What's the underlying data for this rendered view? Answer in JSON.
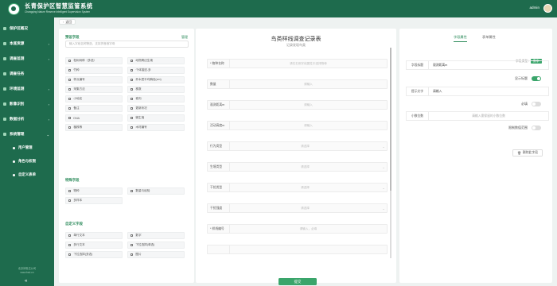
{
  "header": {
    "title": "长青保护区智慧监管系统",
    "subtitle": "Changqing Nature Reserve Intelligent Supervision System",
    "user": "admin"
  },
  "sidebar": {
    "items": [
      {
        "label": "保护区概况"
      },
      {
        "label": "本底资源"
      },
      {
        "label": "调查监测"
      },
      {
        "label": "调查任务"
      },
      {
        "label": "环境监测"
      },
      {
        "label": "影像识别"
      },
      {
        "label": "数据分析"
      },
      {
        "label": "系统管理"
      }
    ],
    "subitems": [
      {
        "label": "用户管理"
      },
      {
        "label": "角色与权限"
      },
      {
        "label": "自定义表单"
      }
    ],
    "footer": [
      "北京博世达公司",
      "www.bsd.cn"
    ],
    "collapse_glyph": "«"
  },
  "tabbar": {
    "back_label": "返回"
  },
  "left_panel": {
    "preset_title": "预设字段",
    "manage_link": "管理",
    "search_placeholder": "输入字段名称筛选，支持拼音首字母",
    "preset_fields": [
      "松树树种（多选）",
      "动物周边生境",
      "竹种",
      "个体描述-多",
      "样点编号",
      "乔木层平均胸径(cm)",
      "采集方法",
      "株数",
      "小地名",
      "坡向",
      "备注",
      "更新状况",
      "DNA",
      "微生境",
      "植株等",
      "木材编号"
    ],
    "special_title": "特殊字段",
    "special_fields": [
      "物种",
      "数量与经验",
      "多样本"
    ],
    "custom_title": "自定义字段",
    "custom_fields": [
      "单行文本",
      "数字",
      "多行文本",
      "下拉选择(单选)",
      "下拉选择(多选)",
      "图片"
    ]
  },
  "form": {
    "title": "鸟类样线调查记录表",
    "subtitle": "记录发现鸟类",
    "rows": [
      {
        "label": "* 物种名称",
        "placeholder": "请在右侧字段属性中选择物种",
        "type": "text"
      },
      {
        "label": "数量",
        "placeholder": "请输入",
        "type": "text"
      },
      {
        "label": "观测距离m",
        "placeholder": "请输入",
        "type": "text"
      },
      {
        "label": "活动高度m",
        "placeholder": "请输入",
        "type": "text"
      },
      {
        "label": "行为类型",
        "placeholder": "请选择",
        "type": "select"
      },
      {
        "label": "生境类型",
        "placeholder": "请选择",
        "type": "select"
      },
      {
        "label": "干扰类型",
        "placeholder": "请选择",
        "type": "select"
      },
      {
        "label": "干扰强度",
        "placeholder": "请选择",
        "type": "select"
      },
      {
        "label": "* 样线编号",
        "placeholder": "请输入，必填",
        "type": "text"
      },
      {
        "label": "",
        "placeholder": "",
        "type": "text"
      }
    ],
    "submit_label": "提交"
  },
  "props": {
    "tabs": [
      "字段属性",
      "表单属性"
    ],
    "field_type_label": "字段类型：",
    "field_type_value": "数字",
    "field_title_label": "字段标题",
    "field_title_value": "观测距离m",
    "show_title_label": "显示标题",
    "show_title_on": true,
    "hint_label": "提示文字",
    "hint_value": "请输入",
    "required_label": "必填",
    "required_on": false,
    "decimal_label": "小数位数",
    "decimal_placeholder": "请输入需保留的小数位数",
    "range_label": "限制数值范围",
    "range_on": false,
    "delete_label": "删除此字段"
  },
  "colors": {
    "primary": "#1e6b4d",
    "accent": "#3aa56b"
  }
}
